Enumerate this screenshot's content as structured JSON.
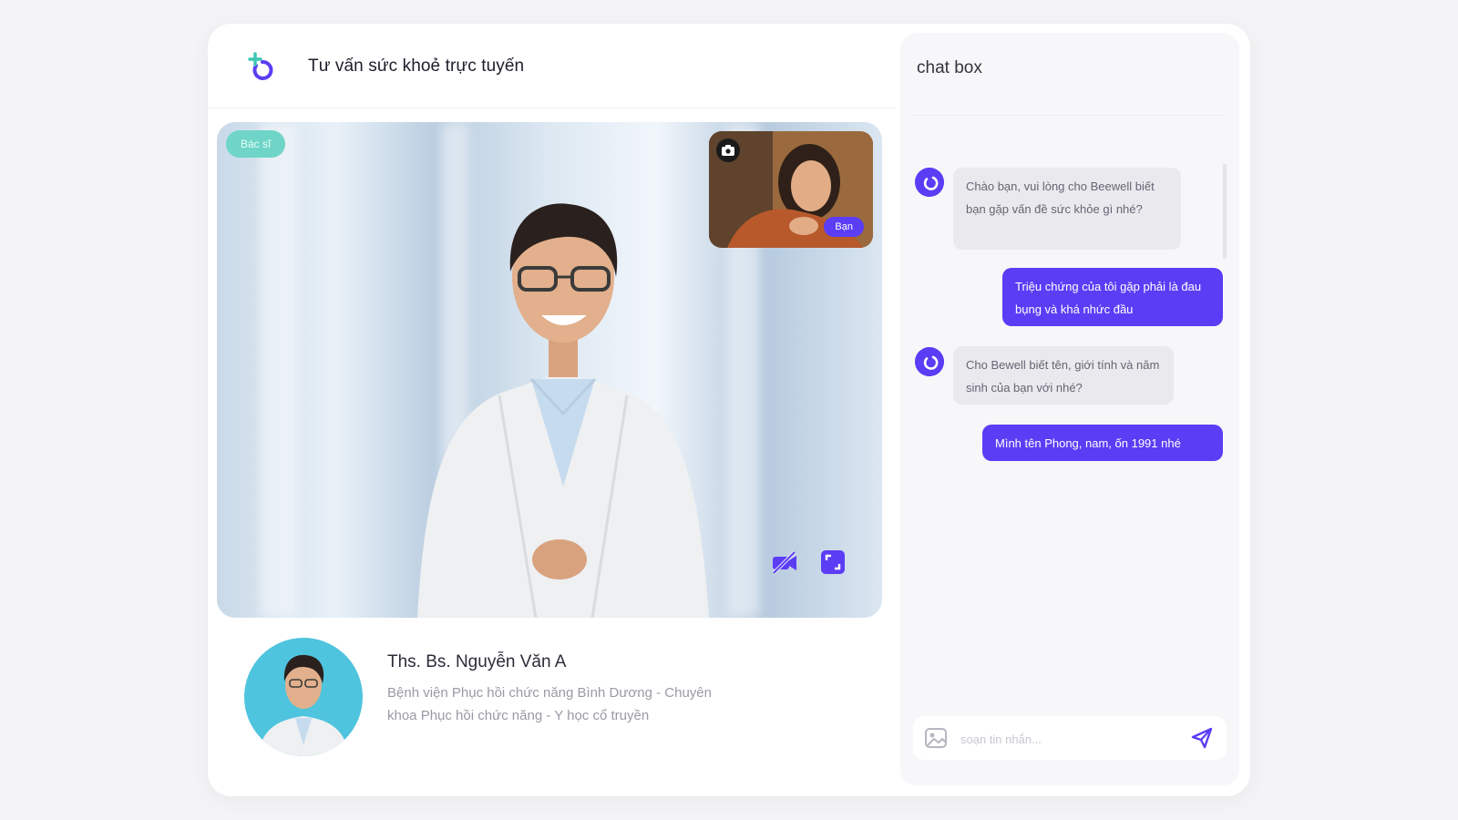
{
  "header": {
    "title": "Tư vấn sức khoẻ trực tuyến"
  },
  "video": {
    "doctor_badge": "Bác sĩ",
    "self_badge": "Bạn"
  },
  "doctor": {
    "name": "Ths. Bs. Nguyễn Văn A",
    "description": "Bệnh viện Phục hồi chức năng Bình Dương - Chuyên khoa Phục hồi chức năng - Y học cổ truyền"
  },
  "chat": {
    "title": "chat box",
    "messages": [
      {
        "from": "bot",
        "text": "Chào bạn, vui lòng cho Beewell biết bạn gặp vấn đề sức khỏe gì nhé?"
      },
      {
        "from": "user",
        "text": "Triệu chứng của tôi gặp phải là đau bụng và khá nhức đầu"
      },
      {
        "from": "bot",
        "text": "Cho Bewell biết tên, giới tính và năm sinh của bạn với nhé?"
      },
      {
        "from": "user",
        "text": "Mình tên Phong, nam, ốn 1991 nhé"
      }
    ],
    "input_placeholder": "soạn tin nhắn..."
  },
  "colors": {
    "accent": "#5b3df5",
    "doctor_badge": "#6fd5c8",
    "logo_teal": "#3cc6b4"
  }
}
